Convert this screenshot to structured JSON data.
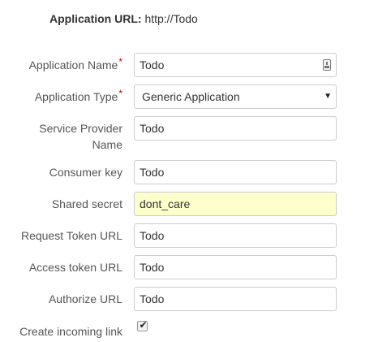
{
  "header": {
    "app_url_label": "Application URL:",
    "app_url_value": "http://Todo"
  },
  "form": {
    "application_name": {
      "label": "Application Name",
      "required_mark": "*",
      "value": "Todo"
    },
    "application_type": {
      "label": "Application Type",
      "required_mark": "*",
      "selected": "Generic Application"
    },
    "service_provider_name": {
      "label": "Service Provider Name",
      "value": "Todo"
    },
    "consumer_key": {
      "label": "Consumer key",
      "value": "Todo"
    },
    "shared_secret": {
      "label": "Shared secret",
      "value": "dont_care"
    },
    "request_token_url": {
      "label": "Request Token URL",
      "value": "Todo"
    },
    "access_token_url": {
      "label": "Access token URL",
      "value": "Todo"
    },
    "authorize_url": {
      "label": "Authorize URL",
      "value": "Todo"
    },
    "create_incoming_link": {
      "label": "Create incoming link",
      "checked": true,
      "check_glyph": "✔"
    }
  },
  "colors": {
    "label": "#555555",
    "required": "#cc0000",
    "highlight_field": "#ffffcc",
    "border": "#cccccc"
  },
  "icons": {
    "autofill": "autofill-icon",
    "dropdown": "chevron-down-icon",
    "check": "checkmark-icon"
  }
}
